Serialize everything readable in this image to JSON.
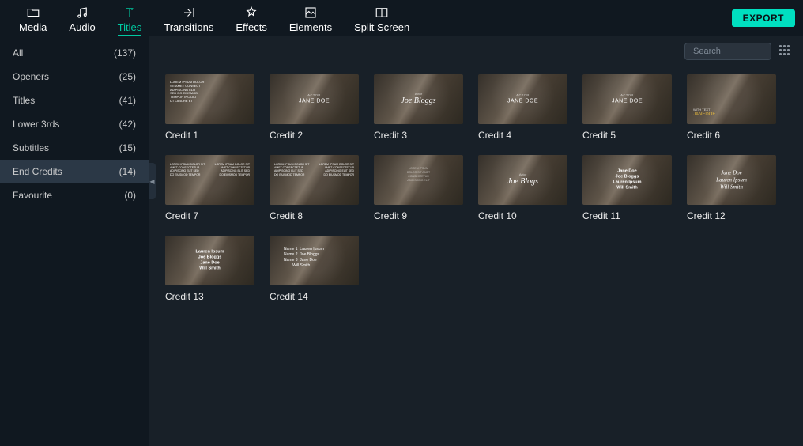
{
  "toolbar": {
    "tabs": [
      {
        "id": "media",
        "label": "Media"
      },
      {
        "id": "audio",
        "label": "Audio"
      },
      {
        "id": "titles",
        "label": "Titles"
      },
      {
        "id": "transitions",
        "label": "Transitions"
      },
      {
        "id": "effects",
        "label": "Effects"
      },
      {
        "id": "elements",
        "label": "Elements"
      },
      {
        "id": "splitscreen",
        "label": "Split Screen"
      }
    ],
    "active": "titles",
    "export_label": "EXPORT"
  },
  "sidebar": {
    "items": [
      {
        "label": "All",
        "count": "(137)"
      },
      {
        "label": "Openers",
        "count": "(25)"
      },
      {
        "label": "Titles",
        "count": "(41)"
      },
      {
        "label": "Lower 3rds",
        "count": "(42)"
      },
      {
        "label": "Subtitles",
        "count": "(15)"
      },
      {
        "label": "End Credits",
        "count": "(14)"
      },
      {
        "label": "Favourite",
        "count": "(0)"
      }
    ],
    "selected": "End Credits"
  },
  "search": {
    "placeholder": "Search"
  },
  "items": [
    {
      "label": "Credit 1",
      "style": "block-left"
    },
    {
      "label": "Credit 2",
      "style": "name-center",
      "text": "JANE DOE"
    },
    {
      "label": "Credit 3",
      "style": "script-center",
      "text": "Joe Bloggs"
    },
    {
      "label": "Credit 4",
      "style": "name-center",
      "text": "JANE DOE"
    },
    {
      "label": "Credit 5",
      "style": "name-center",
      "text": "JANE DOE"
    },
    {
      "label": "Credit 6",
      "style": "bl-yellow",
      "text": "JANEDOE"
    },
    {
      "label": "Credit 7",
      "style": "columns"
    },
    {
      "label": "Credit 8",
      "style": "columns"
    },
    {
      "label": "Credit 9",
      "style": "columns-faded"
    },
    {
      "label": "Credit 10",
      "style": "script-center",
      "text": "Joe Blogs"
    },
    {
      "label": "Credit 11",
      "style": "stack",
      "text": "Jane Doe\nJoe Bloggs\nLauren Ipsum\nWill Smith"
    },
    {
      "label": "Credit 12",
      "style": "script-stack",
      "text": "Jane Doe\nLauren Ipsum\nWill Smith"
    },
    {
      "label": "Credit 13",
      "style": "stack",
      "text": "Lauren Ipsum\nJoe Bloggs\nJane Doe\nWill Smith"
    },
    {
      "label": "Credit 14",
      "style": "left-stack",
      "text": "Name 1  Lauren Ipsum\nName 2  Joe Bloggs\nName 3  Jane Doe\n        Will Smith"
    }
  ]
}
